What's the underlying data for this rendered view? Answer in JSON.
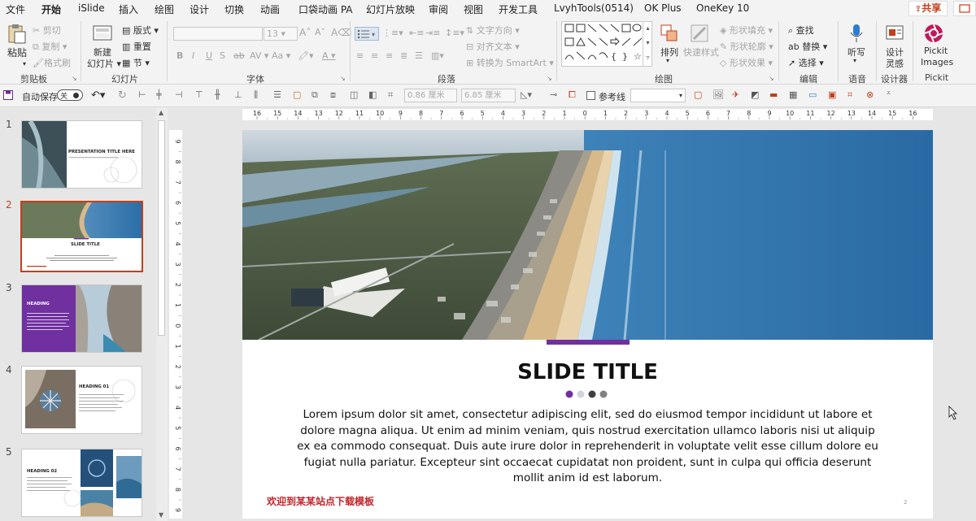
{
  "menu": {
    "tabs": [
      "文件",
      "开始",
      "iSlide",
      "插入",
      "绘图",
      "设计",
      "切换",
      "动画",
      "口袋动画 PA",
      "幻灯片放映",
      "审阅",
      "视图",
      "开发工具",
      "LvyhTools(0514)",
      "OK Plus",
      "OneKey 10"
    ],
    "active_tab": "开始",
    "share_label": "共享"
  },
  "ribbon": {
    "clipboard": {
      "label": "剪贴板",
      "paste": "粘贴",
      "cut": "剪切",
      "copy": "复制",
      "format_painter": "格式刷"
    },
    "slides": {
      "label": "幻灯片",
      "new_slide": "新建",
      "new_slide2": "幻灯片",
      "layout": "版式",
      "reset": "重置",
      "section": "节"
    },
    "font": {
      "label": "字体",
      "size_value": "13",
      "bold": "B",
      "italic": "I",
      "underline": "U",
      "strike": "S",
      "spacing": "AV",
      "case": "Aa",
      "color": "A"
    },
    "paragraph": {
      "label": "段落",
      "text_direction": "文字方向",
      "align_text": "对齐文本",
      "smartart": "转换为 SmartArt"
    },
    "drawing": {
      "label": "绘图",
      "arrange": "排列",
      "quick_styles": "快速样式",
      "shape_fill": "形状填充",
      "shape_outline": "形状轮廓",
      "shape_effects": "形状效果"
    },
    "editing": {
      "label": "编辑",
      "find": "查找",
      "replace": "替换",
      "select": "选择"
    },
    "voice": {
      "label": "语音",
      "dictate": "听写"
    },
    "designer": {
      "label": "设计器",
      "ideas": "设计",
      "ideas2": "灵感"
    },
    "pickit": {
      "label": "Pickit",
      "btn": "Pickit",
      "btn2": "Images"
    }
  },
  "qat": {
    "autosave": "自动保存",
    "toggle_state": "关",
    "width_value": "0.86 厘米",
    "height_value": "6.85 厘米",
    "guides": "参考线"
  },
  "ruler": {
    "h_ticks": [
      "16",
      "15",
      "14",
      "13",
      "12",
      "11",
      "10",
      "9",
      "8",
      "7",
      "6",
      "5",
      "4",
      "3",
      "2",
      "1",
      "0",
      "1",
      "2",
      "3",
      "4",
      "5",
      "6",
      "7",
      "8",
      "9",
      "10",
      "11",
      "12",
      "13",
      "14",
      "15",
      "16"
    ],
    "v_ticks": [
      "9",
      "8",
      "7",
      "6",
      "5",
      "4",
      "3",
      "2",
      "1",
      "0",
      "1",
      "2",
      "3",
      "4",
      "5",
      "6",
      "7",
      "8",
      "9"
    ]
  },
  "thumbnails": [
    {
      "num": "1",
      "heading": "PRESENTATION TITLE HERE"
    },
    {
      "num": "2",
      "heading": "SLIDE TITLE"
    },
    {
      "num": "3",
      "heading": "HEADING"
    },
    {
      "num": "4",
      "heading": "HEADING 01"
    },
    {
      "num": "5",
      "heading": "HEADING 02"
    }
  ],
  "slide": {
    "title": "SLIDE TITLE",
    "body": "Lorem ipsum dolor sit amet, consectetur adipiscing elit, sed do eiusmod tempor incididunt ut labore et dolore magna aliqua. Ut enim ad minim veniam, quis nostrud exercitation ullamco laboris nisi ut aliquip ex ea commodo consequat. Duis aute irure dolor in reprehenderit in voluptate velit esse cillum dolore eu fugiat nulla pariatur. Excepteur sint occaecat cupidatat non proident, sunt in culpa qui officia deserunt mollit anim id est laborum.",
    "footer_note": "欢迎到某某站点下载模板",
    "page_number": "2",
    "dots": [
      "#7030a0",
      "#d0d4dc",
      "#404040",
      "#808080"
    ]
  },
  "colors": {
    "accent": "#c43e1c",
    "purple": "#7030a0",
    "thumb3_purple": "#7030a0"
  }
}
